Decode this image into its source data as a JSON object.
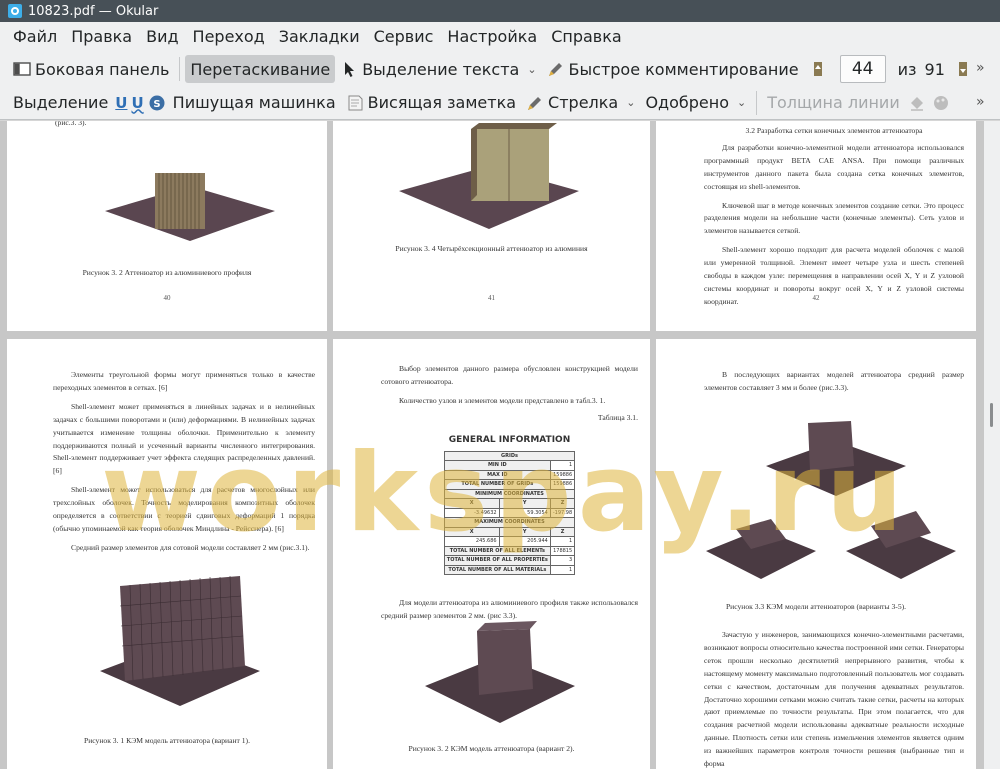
{
  "window": {
    "title": "10823.pdf  — Okular"
  },
  "menu": [
    "Файл",
    "Правка",
    "Вид",
    "Переход",
    "Закладки",
    "Сервис",
    "Настройка",
    "Справка"
  ],
  "toolbar1": {
    "sidebar": "Боковая панель",
    "drag": "Перетаскивание",
    "text_select": "Выделение текста",
    "quick_annot": "Быстрое комментирование",
    "page_current": "44",
    "of": "из",
    "page_total": "91"
  },
  "toolbar2": {
    "selection": "Выделение",
    "typewriter": "Пишущая машинка",
    "note": "Висящая заметка",
    "arrow": "Стрелка",
    "stamp": "Одобрено",
    "line_width": "Толщина линии"
  },
  "watermark": "workspay.ru",
  "pages": {
    "p40": {
      "top_text": "(рис.3. 3).",
      "caption": "Рисунок 3. 2 Аттенюатор из алюминиевого профиля",
      "num": "40"
    },
    "p41": {
      "caption": "Рисунок 3. 4 Четырёхсекционный аттенюатор из алюминия",
      "num": "41"
    },
    "p42": {
      "heading": "3.2 Разработка сетки конечных элементов аттенюатора",
      "para1": "Для разработки конечно-элементной модели аттенюатора использовался программный продукт BETA CAE ANSA. При помощи различных инструментов данного пакета была создана сетка конечных элементов, состоящая из shell-элементов.",
      "para2": "Ключевой шаг в методе конечных элементов создание сетки. Это процесс разделения модели на небольшие части (конечные элементы). Сеть узлов и элементов называется сеткой.",
      "para3": "Shell-элемент хорошо подходит для расчета моделей оболочек с малой или умеренной толщиной. Элемент имеет четыре узла и шесть степеней свободы в каждом узле: перемещения в направлении осей X, Y и Z узловой системы координат и повороты вокруг осей X, Y и Z узловой системы координат.",
      "num": "42"
    },
    "p43": {
      "para1": "Элементы треугольной формы могут применяться только в качестве переходных элементов в сетках. [6]",
      "para2": "Shell-элемент может применяться в линейных задачах и в нелинейных задачах с большими поворотами и (или) деформациями. В нелинейных задачах учитывается изменение толщины оболочки. Применительно к элементу поддерживаются полный и усеченный варианты численного интегрирования. Shell-элемент поддерживает учет эффекта следящих распределенных давлений. [6]",
      "para3": "Shell-элемент может использоваться для расчетов многослойных или трехслойных оболочек. Точность моделирования композитных оболочек определяется в соответствии с теорией сдвиговых деформаций 1 порядка (обычно упоминаемой как теория оболочек Миндлина - Рейсснера). [6]",
      "para4": "Средний размер элементов для сотовой модели составляет 2 мм (рис.3.1).",
      "caption": "Рисунок 3. 1 КЭМ модель аттенюатора (вариант 1)."
    },
    "p44": {
      "para1": "Выбор элементов данного размера обусловлен конструкцией модели сотового аттенюатора.",
      "para2": "Количество узлов и элементов модели представлено в табл.3. 1.",
      "table_label": "Таблица 3.1.",
      "table_title": "GENERAL INFORMATION",
      "para3": "Для модели аттенюатора из алюминиевого профиля также использовался средний размер элементов 2 мм. (рис 3.3).",
      "caption": "Рисунок 3. 2 КЭМ модель аттенюатора (вариант 2)."
    },
    "p45": {
      "para1": "В последующих вариантах моделей аттенюатора средний размер элементов составляет 3 мм и более (рис.3.3).",
      "caption": "Рисунок 3.3 КЭМ модели аттенюаторов (варианты 3-5).",
      "para2": "Зачастую у инженеров, занимающихся конечно-элементными расчетами, возникают вопросы относительно качества построенной ими сетки. Генераторы сеток прошли несколько десятилетий непрерывного развития, чтобы к настоящему моменту максимально подготовленный пользователь мог создавать сетки с качеством, достаточным для получения адекватных результатов. Достаточно хорошими сетками можно считать такие сетки, расчеты на которых дают приемлемые по точности результаты. При этом полагается, что для создания расчетной модели использованы адекватные реальности исходные данные. Плотность сетки или степень измельчения элементов является одним из важнейших параметров контроля точности решения (выбранные тип и форма"
    }
  },
  "table": {
    "grids": "GRIDs",
    "min_id_label": "MIN ID",
    "min_id": "1",
    "max_id_label": "MAX ID",
    "max_id": "159886",
    "total_grids_label": "TOTAL NUMBER OF GRIDs",
    "total_grids": "159886",
    "min_coords": "MINIMUM COORDINATES",
    "max_coords": "MAXIMUM COORDINATES",
    "x": "X",
    "y": "Y",
    "z": "Z",
    "min_x": "-3.49632",
    "min_y": "59.3054",
    "min_z": "-197.98",
    "max_x": "245.686",
    "max_y": "205.944",
    "max_z": "1",
    "total_elements_label": "TOTAL NUMBER OF ALL ELEMENTs",
    "total_elements": "178815",
    "total_properties_label": "TOTAL NUMBER OF ALL PROPERTIEs",
    "total_properties": "3",
    "total_materials_label": "TOTAL NUMBER OF ALL MATERIALs",
    "total_materials": "1"
  },
  "colors": {
    "accent": "#3daee9",
    "watermark": "#deb43c",
    "model_base": "#5a4650",
    "model_body": "#8c7a5e"
  }
}
